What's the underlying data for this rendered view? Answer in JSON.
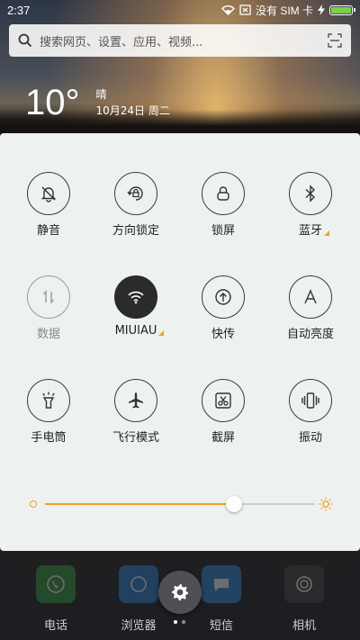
{
  "status_bar": {
    "time": "2:37",
    "carrier": "没有 SIM 卡"
  },
  "search": {
    "placeholder": "搜索网页、设置、应用、视频..."
  },
  "weather": {
    "temperature": "10°",
    "condition": "晴",
    "date": "10月24日 周二"
  },
  "quick_settings": {
    "rows": [
      [
        {
          "label": "静音",
          "icon": "bell-off-icon",
          "state": "off"
        },
        {
          "label": "方向锁定",
          "icon": "rotation-lock-icon",
          "state": "off"
        },
        {
          "label": "锁屏",
          "icon": "lock-icon",
          "state": "off"
        },
        {
          "label": "蓝牙",
          "icon": "bluetooth-icon",
          "state": "off",
          "has_menu": true
        }
      ],
      [
        {
          "label": "数据",
          "icon": "data-arrows-icon",
          "state": "disabled"
        },
        {
          "label": "MIUIAU",
          "icon": "wifi-icon",
          "state": "on",
          "has_menu": true
        },
        {
          "label": "快传",
          "icon": "fast-transfer-icon",
          "state": "off"
        },
        {
          "label": "自动亮度",
          "icon": "auto-brightness-icon",
          "state": "off"
        }
      ],
      [
        {
          "label": "手电筒",
          "icon": "flashlight-icon",
          "state": "off"
        },
        {
          "label": "飞行模式",
          "icon": "airplane-icon",
          "state": "off"
        },
        {
          "label": "截屏",
          "icon": "screenshot-icon",
          "state": "off"
        },
        {
          "label": "振动",
          "icon": "vibrate-icon",
          "state": "off"
        }
      ]
    ],
    "brightness": 0.7
  },
  "dock": {
    "apps": [
      {
        "label": "电话",
        "color": "#2f9a3a"
      },
      {
        "label": "浏览器",
        "color": "#2a7fd4"
      },
      {
        "label": "短信",
        "color": "#2a8ad8"
      },
      {
        "label": "相机",
        "color": "#333333"
      }
    ]
  },
  "colors": {
    "accent": "#f0a020",
    "panel": "#edf2f1"
  }
}
